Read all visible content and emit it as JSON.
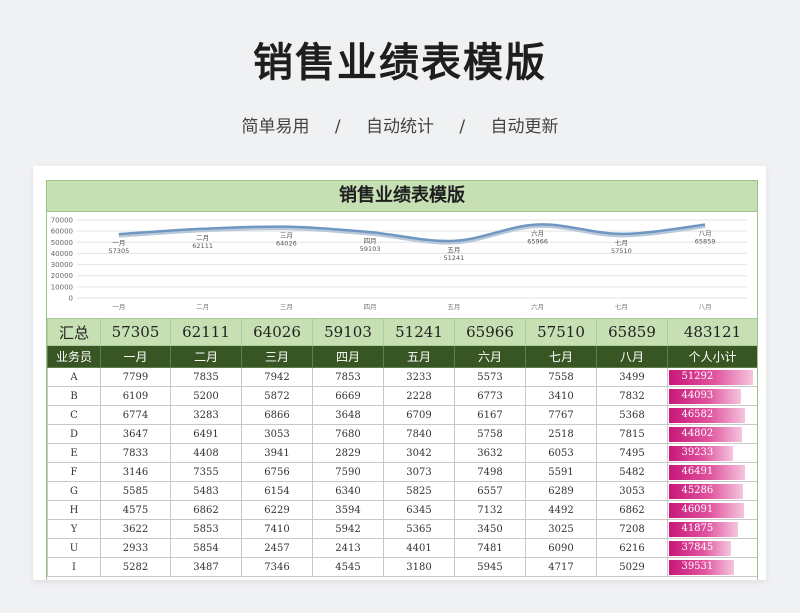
{
  "title": "销售业绩表模版",
  "subtitle": [
    "简单易用",
    "/",
    "自动统计",
    "/",
    "自动更新"
  ],
  "sheet": {
    "title": "销售业绩表模版",
    "summary_label": "汇总",
    "header": [
      "业务员",
      "一月",
      "二月",
      "三月",
      "四月",
      "五月",
      "六月",
      "七月",
      "八月",
      "个人小计"
    ],
    "rows": [
      {
        "name": "A",
        "values": [
          "7799",
          "7835",
          "7942",
          "7853",
          "3233",
          "5573",
          "7558",
          "3499"
        ],
        "total": "51292",
        "total_value": 51292
      },
      {
        "name": "B",
        "values": [
          "6109",
          "5200",
          "5872",
          "6669",
          "2228",
          "6773",
          "3410",
          "7832"
        ],
        "total": "44093",
        "total_value": 44093
      },
      {
        "name": "C",
        "values": [
          "6774",
          "3283",
          "6866",
          "3648",
          "6709",
          "6167",
          "7767",
          "5368"
        ],
        "total": "46582",
        "total_value": 46582
      },
      {
        "name": "D",
        "values": [
          "3647",
          "6491",
          "3053",
          "7680",
          "7840",
          "5758",
          "2518",
          "7815"
        ],
        "total": "44802",
        "total_value": 44802
      },
      {
        "name": "E",
        "values": [
          "7833",
          "4408",
          "3941",
          "2829",
          "3042",
          "3632",
          "6053",
          "7495"
        ],
        "total": "39233",
        "total_value": 39233
      },
      {
        "name": "F",
        "values": [
          "3146",
          "7355",
          "6756",
          "7590",
          "3073",
          "7498",
          "5591",
          "5482"
        ],
        "total": "46491",
        "total_value": 46491
      },
      {
        "name": "G",
        "values": [
          "5585",
          "5483",
          "6154",
          "6340",
          "5825",
          "6557",
          "6289",
          "3053"
        ],
        "total": "45286",
        "total_value": 45286
      },
      {
        "name": "H",
        "values": [
          "4575",
          "6862",
          "6229",
          "3594",
          "6345",
          "7132",
          "4492",
          "6862"
        ],
        "total": "46091",
        "total_value": 46091
      },
      {
        "name": "Y",
        "values": [
          "3622",
          "5853",
          "7410",
          "5942",
          "5365",
          "3450",
          "3025",
          "7208"
        ],
        "total": "41875",
        "total_value": 41875
      },
      {
        "name": "U",
        "values": [
          "2933",
          "5854",
          "2457",
          "2413",
          "4401",
          "7481",
          "6090",
          "6216"
        ],
        "total": "37845",
        "total_value": 37845
      },
      {
        "name": "I",
        "values": [
          "5282",
          "3487",
          "7346",
          "4545",
          "3180",
          "5945",
          "4717",
          "5029"
        ],
        "total": "39531",
        "total_value": 39531
      }
    ]
  },
  "chart_data": {
    "type": "line",
    "categories": [
      "一月",
      "二月",
      "三月",
      "四月",
      "五月",
      "六月",
      "七月",
      "八月"
    ],
    "series": [
      {
        "values": [
          57305,
          62111,
          64026,
          59103,
          51241,
          65966,
          57510,
          65859
        ]
      }
    ],
    "data_labels": [
      "57305",
      "62111",
      "64026",
      "59103",
      "51241",
      "65966",
      "57510",
      "65859"
    ],
    "grand_total": "483121",
    "y_ticks": [
      "70000",
      "60000",
      "50000",
      "40000",
      "30000",
      "20000",
      "10000",
      "0"
    ],
    "ylim": [
      0,
      70000
    ],
    "grid": true,
    "line_color": "#6f97c1",
    "title": "",
    "xlabel": "",
    "ylabel": ""
  }
}
